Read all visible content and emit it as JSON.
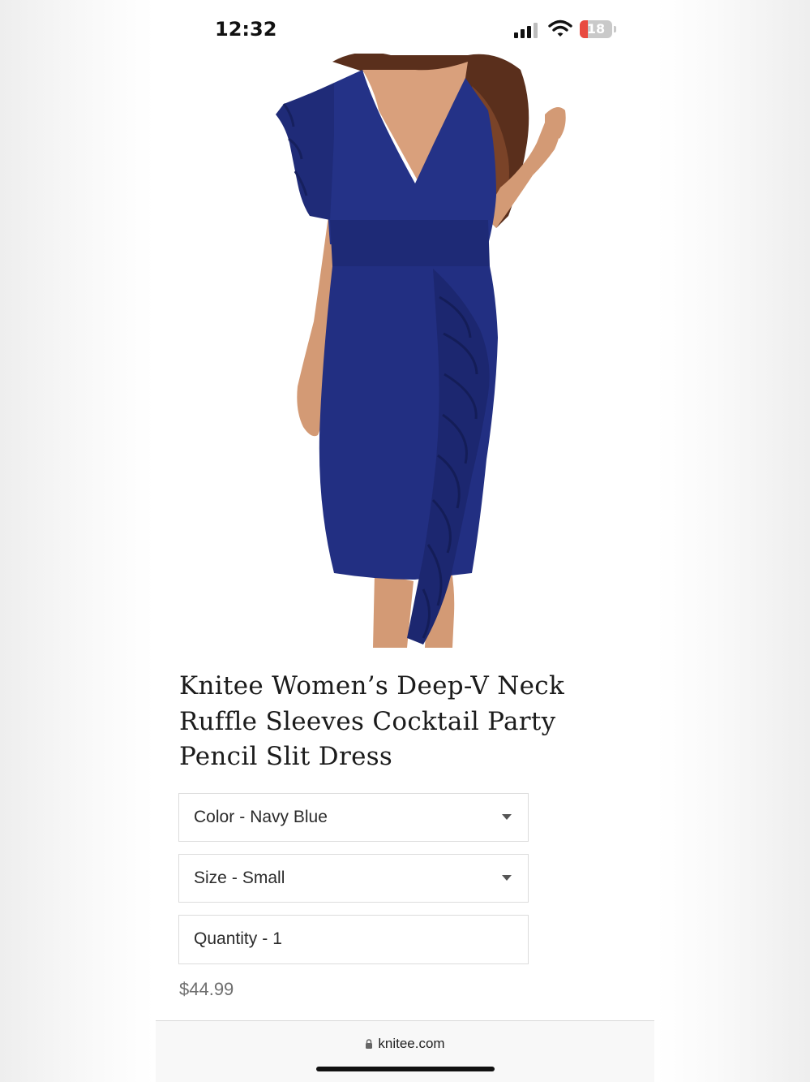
{
  "status_bar": {
    "time": "12:32",
    "battery_level": "18",
    "battery_color": "#e84a40",
    "icons": [
      "cellular-signal-icon",
      "wifi-icon",
      "battery-icon"
    ]
  },
  "product": {
    "image": "navy-blue-ruffle-dress-photo",
    "title": "Knitee Women’s Deep-V Neck Ruffle Sleeves Cocktail Party Pencil Slit Dress",
    "options": {
      "color_label": "Color",
      "color_value": "Navy Blue",
      "size_label": "Size",
      "size_value": "Small",
      "quantity_label": "Quantity",
      "quantity_value": "1",
      "separator": "-"
    },
    "price": "$44.99",
    "dress_color": "#1f2d7a"
  },
  "browser": {
    "url": "knitee.com"
  }
}
